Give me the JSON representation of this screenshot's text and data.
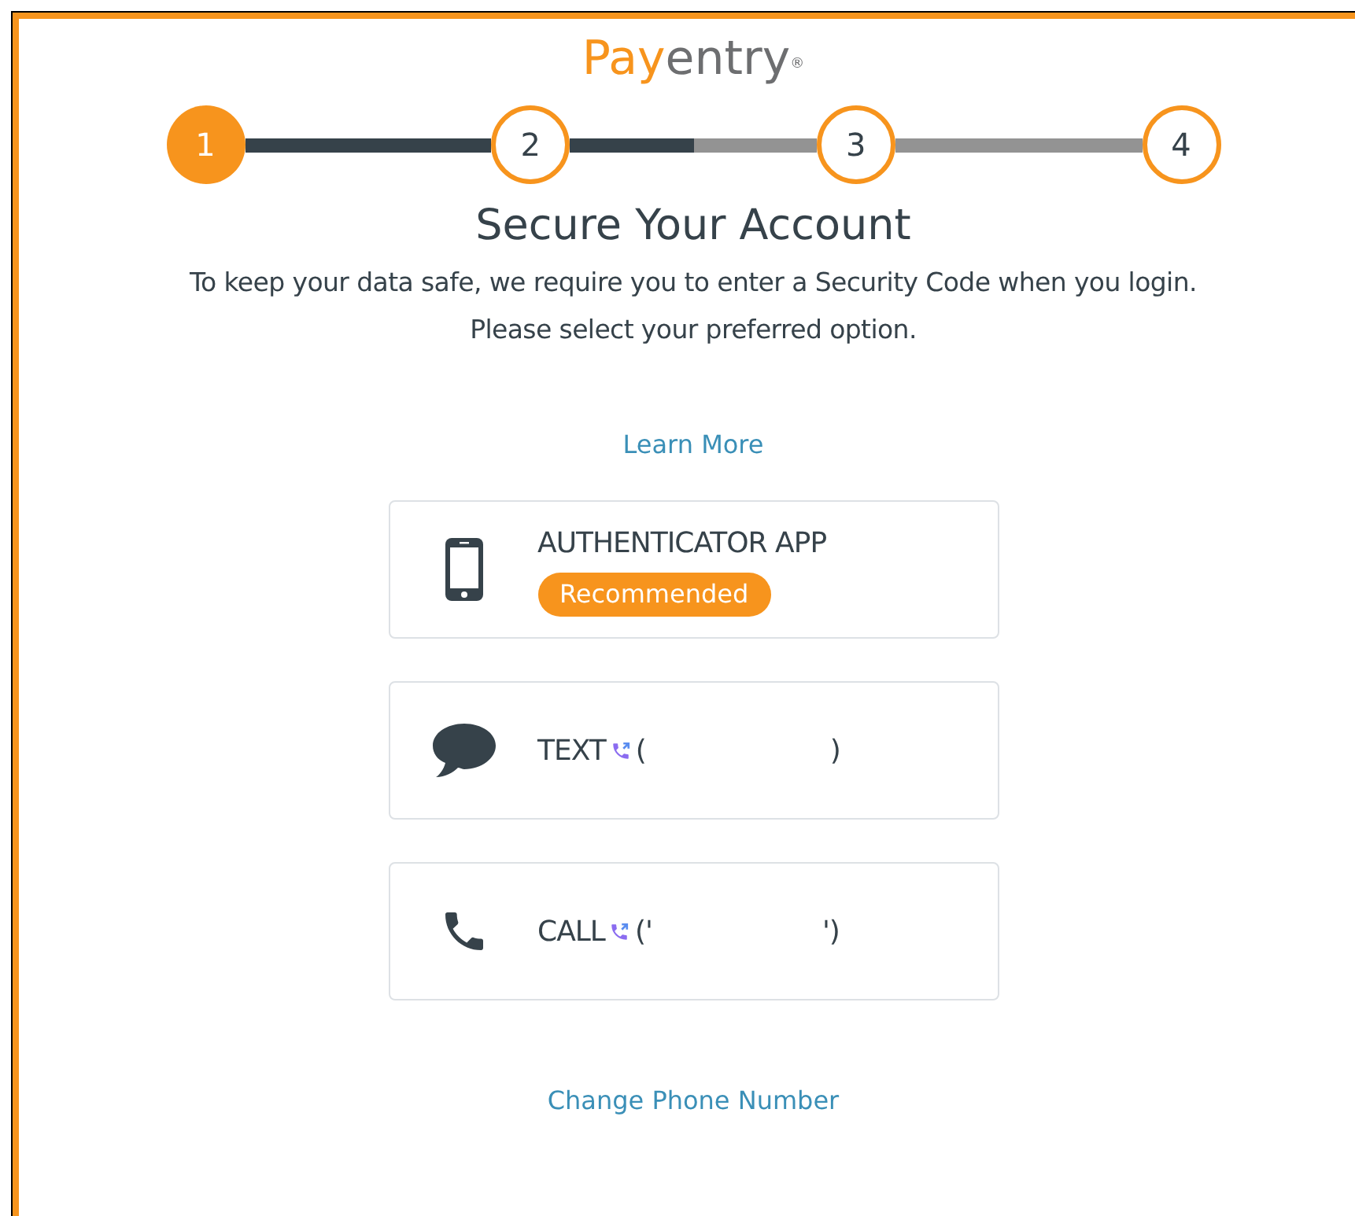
{
  "logo": {
    "part_1": "Pay",
    "part_2": "entry",
    "mark": "®"
  },
  "stepper": {
    "connectors": [
      {
        "parts": [
          {
            "filled": true
          }
        ]
      },
      {
        "parts": [
          {
            "filled": true
          },
          {
            "filled": false
          }
        ]
      },
      {
        "parts": [
          {
            "filled": false
          }
        ]
      }
    ],
    "steps": [
      {
        "label": "1",
        "selected": true
      },
      {
        "label": "2",
        "selected": false
      },
      {
        "label": "3",
        "selected": false
      },
      {
        "label": "4",
        "selected": false
      }
    ]
  },
  "heading": "Secure Your Account",
  "description": [
    "To keep your data safe, we require you to enter a Security Code when you login.",
    "Please select your preferred option."
  ],
  "learn_more": "Learn More",
  "options": [
    {
      "kind": "app",
      "label": "AUTHENTICATOR APP",
      "badge": "Recommended"
    },
    {
      "kind": "text",
      "label": "TEXT",
      "number_start": "(",
      "number_end": ")"
    },
    {
      "kind": "call",
      "label": "CALL",
      "number_start": "('",
      "number_end": "')"
    }
  ],
  "change_phone": "Change Phone Number"
}
